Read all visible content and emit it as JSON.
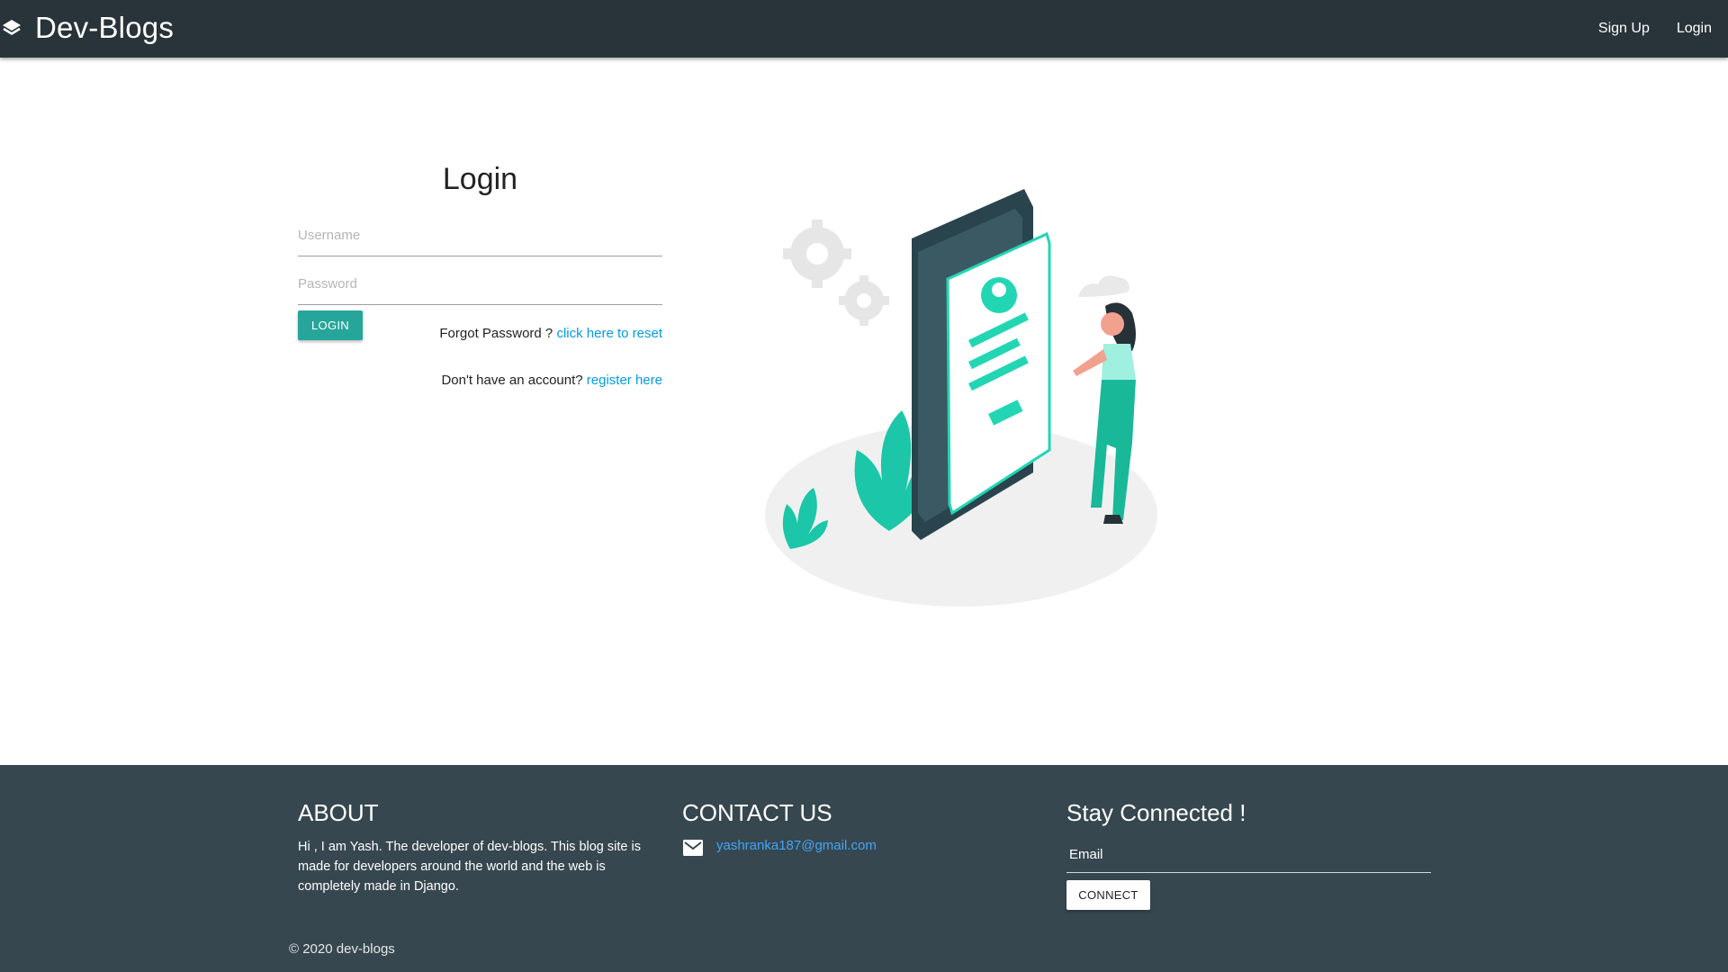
{
  "navbar": {
    "brand": "Dev-Blogs",
    "brand_icon": "layers-icon",
    "links": [
      "Sign Up",
      "Login"
    ]
  },
  "login": {
    "title": "Login",
    "username_placeholder": "Username",
    "password_placeholder": "Password",
    "button_label": "LOGIN",
    "forgot_text": "Forgot Password ? ",
    "forgot_link": "click here to reset",
    "register_text": "Don't have an account? ",
    "register_link": "register here"
  },
  "illustration": {
    "subject": "woman-with-phone-login-illustration"
  },
  "footer": {
    "about": {
      "heading": "ABOUT",
      "text": "Hi , I am Yash. The developer of dev-blogs. This blog site is made for developers around the world and the web is completely made in Django."
    },
    "contact": {
      "heading": "CONTACT US",
      "icon": "mail-icon",
      "email": "yashranka187@gmail.com"
    },
    "stay": {
      "heading": "Stay Connected !",
      "email_placeholder": "Email",
      "button_label": "CONNECT"
    },
    "copyright": "© 2020 dev-blogs"
  },
  "colors": {
    "navbar_bg": "#29343a",
    "footer_bg": "#37474f",
    "accent": "#26a69a",
    "link": "#039be5"
  }
}
